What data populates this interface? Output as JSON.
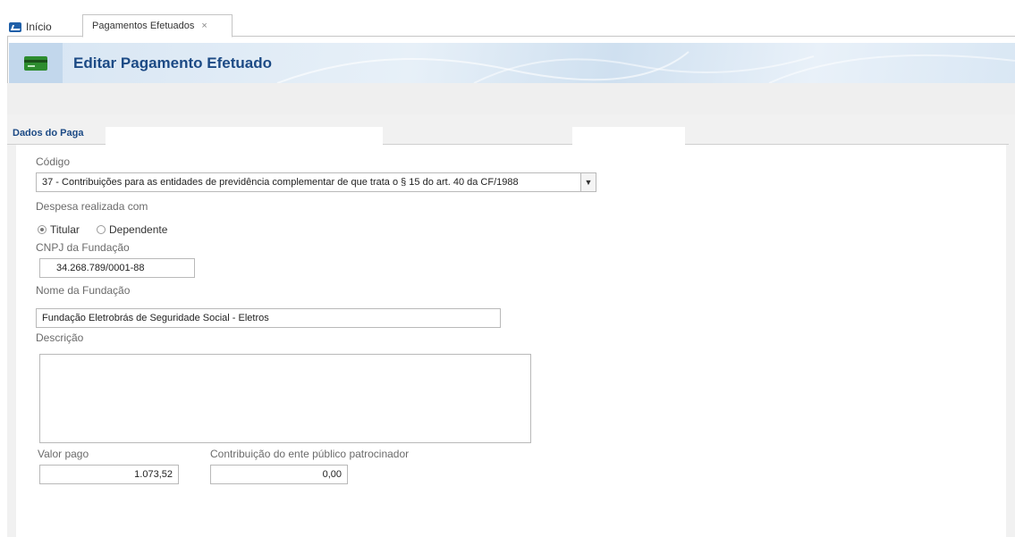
{
  "tabs": {
    "home_label": "Início",
    "active_label": "Pagamentos Efetuados",
    "close_glyph": "×"
  },
  "header": {
    "title": "Editar Pagamento Efetuado",
    "icon": "credit-card-icon"
  },
  "panel": {
    "title": "Dados do Paga"
  },
  "form": {
    "codigo_label": "Código",
    "codigo_value": "37 - Contribuições para as entidades de previdência complementar de que trata o § 15 do art. 40 da CF/1988",
    "despesa_label": "Despesa realizada com",
    "radio_titular": "Titular",
    "radio_dependente": "Dependente",
    "selected_radio": "Titular",
    "cnpj_label": "CNPJ da Fundação",
    "cnpj_value": "34.268.789/0001-88",
    "nome_label": "Nome da Fundação",
    "nome_value": "Fundação Eletrobrás de Seguridade Social - Eletros",
    "descricao_label": "Descrição",
    "descricao_value": "",
    "valor_pago_label": "Valor pago",
    "valor_pago_value": "1.073,52",
    "contribuicao_label": "Contribuição do ente público patrocinador",
    "contribuicao_value": "0,00"
  },
  "colors": {
    "accent": "#1c4a85",
    "card_icon": "#2d8c2f"
  }
}
